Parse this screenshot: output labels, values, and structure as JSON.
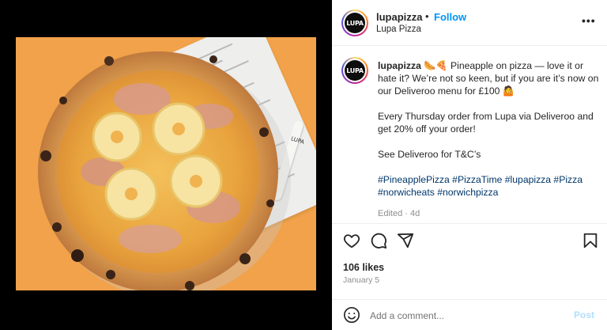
{
  "post": {
    "username": "lupapizza",
    "separator": "•",
    "follow_label": "Follow",
    "location": "Lupa Pizza",
    "more_icon": "more-horizontal-icon",
    "more_label": "•••",
    "avatar_logo_text": "LUPA"
  },
  "caption": {
    "username": "lupapizza",
    "line1": "🌭🍕 Pineapple on pizza — love it or hate it? We’re not so keen, but if you are it’s now on our Deliveroo menu for £100 🤷",
    "line2": "Every Thursday order from Lupa via Deliveroo and get 20% off your order!",
    "line3": "See Deliveroo for T&C’s",
    "hashtags": "#PineapplePizza #PizzaTime #lupapizza #Pizza #norwicheats #norwichpizza",
    "meta": "Edited · 4d"
  },
  "actions": {
    "like_icon": "heart-icon",
    "comment_icon": "comment-icon",
    "share_icon": "share-icon",
    "save_icon": "bookmark-icon",
    "likes": "106 likes",
    "date": "January 5"
  },
  "comment_box": {
    "emoji_icon": "emoji-icon",
    "placeholder": "Add a comment...",
    "post_label": "Post"
  },
  "media": {
    "pen_text": "LUPA"
  },
  "colors": {
    "accent": "#0095f6",
    "hashtag": "#00376b",
    "background_photo": "#f1a24a",
    "post_disabled": "#b2dffc"
  }
}
